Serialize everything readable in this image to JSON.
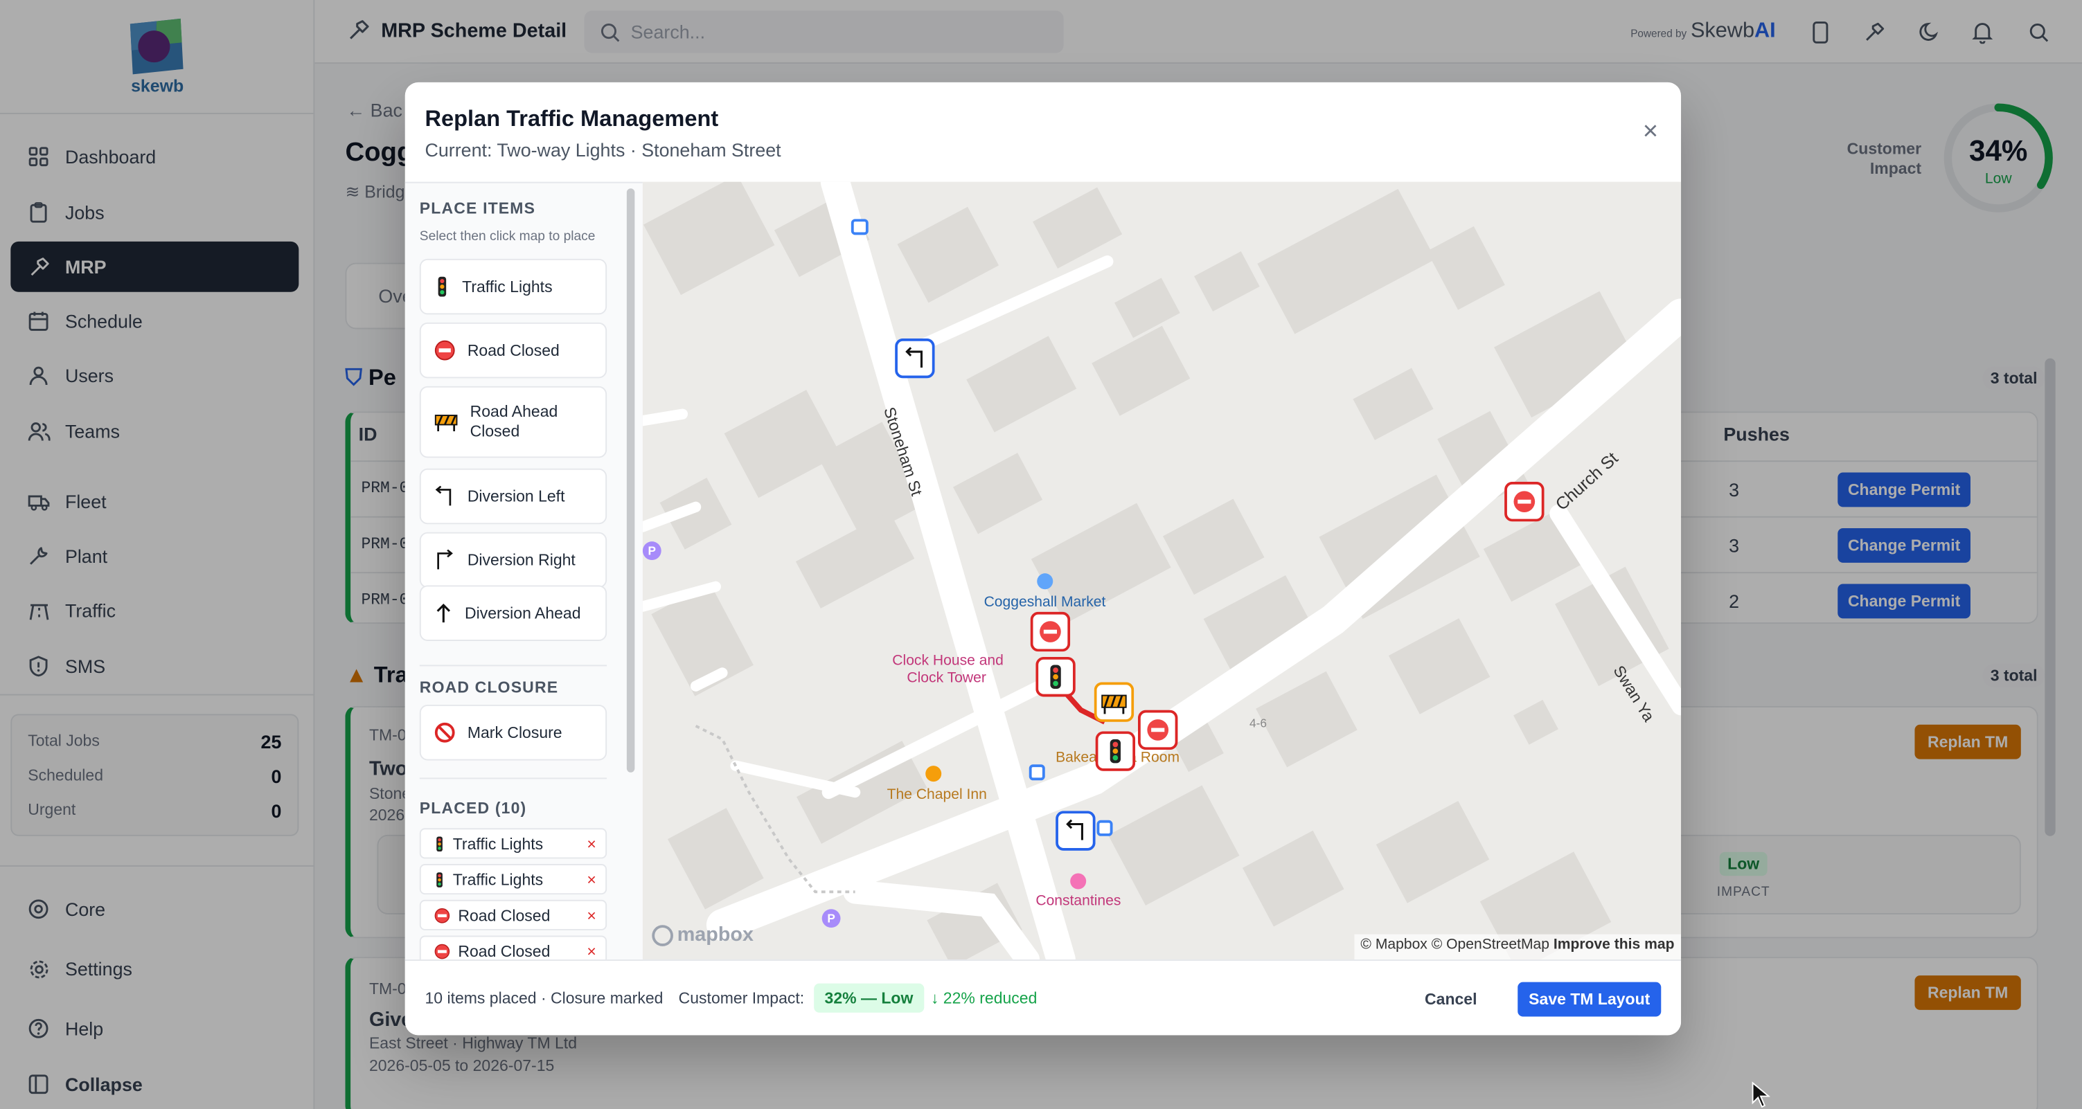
{
  "app": {
    "logo_text": "skewb",
    "header_title": "MRP Scheme Detail",
    "search_placeholder": "Search...",
    "powered_by": "Powered by",
    "brand_name": "Skewb",
    "brand_suffix": "AI"
  },
  "sidebar": {
    "items": [
      {
        "label": "Dashboard",
        "icon": "dashboard-icon"
      },
      {
        "label": "Jobs",
        "icon": "clipboard-icon"
      },
      {
        "label": "MRP",
        "icon": "hammer-icon",
        "active": true
      },
      {
        "label": "Schedule",
        "icon": "calendar-icon"
      },
      {
        "label": "Users",
        "icon": "user-icon"
      },
      {
        "label": "Teams",
        "icon": "team-icon"
      },
      {
        "label": "Fleet",
        "icon": "truck-icon"
      },
      {
        "label": "Plant",
        "icon": "wrench-icon"
      },
      {
        "label": "Traffic",
        "icon": "traffic-icon"
      },
      {
        "label": "SMS",
        "icon": "shield-icon"
      }
    ],
    "stats": [
      {
        "label": "Total Jobs",
        "value": "25"
      },
      {
        "label": "Scheduled",
        "value": "0"
      },
      {
        "label": "Urgent",
        "value": "0"
      }
    ],
    "bottom": [
      {
        "label": "Core",
        "icon": "layers-icon"
      },
      {
        "label": "Settings",
        "icon": "gear-icon"
      },
      {
        "label": "Help",
        "icon": "help-icon"
      }
    ],
    "collapse_label": "Collapse"
  },
  "background": {
    "back_label": "Bac",
    "page_title": "Cogg",
    "subtitle": "Bridg",
    "tab_label": "Ove",
    "permits_title": "Pe",
    "permits_total": "3 total",
    "col_id": "ID",
    "col_pushes": "Pushes",
    "permits": [
      {
        "id": "PRM-0",
        "pushes": "3",
        "action": "Change Permit"
      },
      {
        "id": "PRM-0",
        "pushes": "3",
        "action": "Change Permit"
      },
      {
        "id": "PRM-0",
        "pushes": "2",
        "action": "Change Permit"
      }
    ],
    "tm_title": "Tra",
    "tm_total": "3 total",
    "tm_items": [
      {
        "id": "TM-0",
        "name": "Two",
        "street": "Stone",
        "dates": "2026",
        "action": "Replan TM",
        "impact": "Low",
        "impact_label": "IMPACT"
      },
      {
        "id": "TM-0",
        "name": "Give",
        "street": "East Street · Highway TM Ltd",
        "dates": "2026-05-05 to 2026-07-15",
        "action": "Replan TM"
      }
    ],
    "customer_impact_label": "Customer Impact",
    "customer_impact_value": "34%",
    "customer_impact_level": "Low",
    "customer_impact_fraction": 0.34
  },
  "modal": {
    "title": "Replan Traffic Management",
    "subtitle": "Current: Two-way Lights · Stoneham Street",
    "close_label": "×",
    "place_heading": "PLACE ITEMS",
    "place_hint": "Select then click map to place",
    "place_items": [
      {
        "label": "Traffic Lights",
        "icon": "traffic-light-icon"
      },
      {
        "label": "Road Closed",
        "icon": "no-entry-icon"
      },
      {
        "label": "Road Ahead Closed",
        "icon": "barrier-icon"
      },
      {
        "label": "Diversion Left",
        "icon": "arrow-left-turn-icon"
      },
      {
        "label": "Diversion Right",
        "icon": "arrow-right-turn-icon"
      },
      {
        "label": "Diversion Ahead",
        "icon": "arrow-up-icon"
      }
    ],
    "closure_heading": "ROAD CLOSURE",
    "closure_item": {
      "label": "Mark Closure",
      "icon": "prohibited-icon"
    },
    "placed_heading": "PLACED (10)",
    "placed": [
      {
        "label": "Traffic Lights",
        "icon": "traffic-light-icon"
      },
      {
        "label": "Traffic Lights",
        "icon": "traffic-light-icon"
      },
      {
        "label": "Road Closed",
        "icon": "no-entry-icon"
      },
      {
        "label": "Road Closed",
        "icon": "no-entry-icon"
      }
    ],
    "remove_label": "×",
    "map": {
      "labels": {
        "stoneham": "Stoneham St",
        "church": "Church St",
        "swan": "Swan Ya",
        "market": "Coggeshall Market",
        "clock1": "Clock House and",
        "clock2": "Clock Tower",
        "chapel": "The Chapel Inn",
        "tearoom": "Bakea... Tea Room",
        "constantines": "Constantines",
        "num": "4-6"
      },
      "attribution": "© Mapbox © OpenStreetMap",
      "improve": "Improve this map",
      "mapbox_logo": "mapbox"
    },
    "footer": {
      "summary": "10 items placed · Closure marked",
      "impact_label": "Customer Impact:",
      "impact_value": "32% — Low",
      "reduced": "22% reduced",
      "cancel": "Cancel",
      "save": "Save TM Layout"
    }
  },
  "colors": {
    "primary": "#2563eb",
    "sidebar_active": "#1f2937",
    "replan": "#d97706",
    "success": "#16a34a",
    "danger": "#dc2626"
  }
}
